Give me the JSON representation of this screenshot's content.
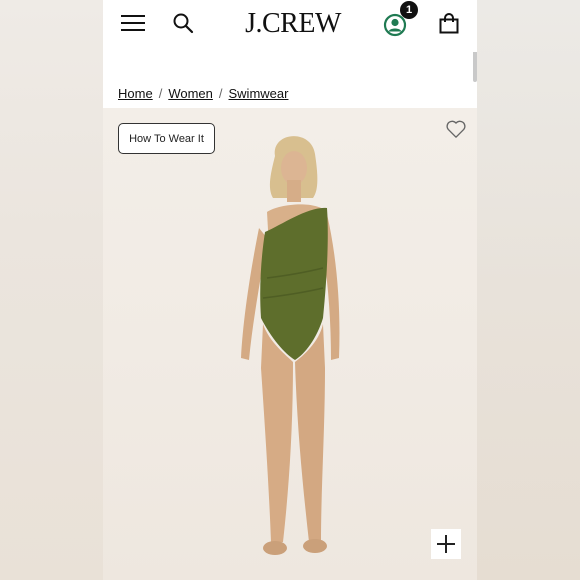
{
  "header": {
    "logo": "J.CREW",
    "cart_badge": "1",
    "icons": [
      "menu-icon",
      "search-icon",
      "account-icon",
      "shopping-bag-icon"
    ]
  },
  "breadcrumb": {
    "items": [
      "Home",
      "Women",
      "Swimwear"
    ],
    "separator": "/"
  },
  "product_image": {
    "how_to_wear_label": "How To Wear It",
    "icons": [
      "heart-icon",
      "plus-icon"
    ]
  },
  "colors": {
    "swimsuit": "#5e6e2c",
    "skin": "#d9b08c",
    "hair": "#d8bf8f",
    "badge": "#111111",
    "account_icon": "#1f7a52"
  }
}
